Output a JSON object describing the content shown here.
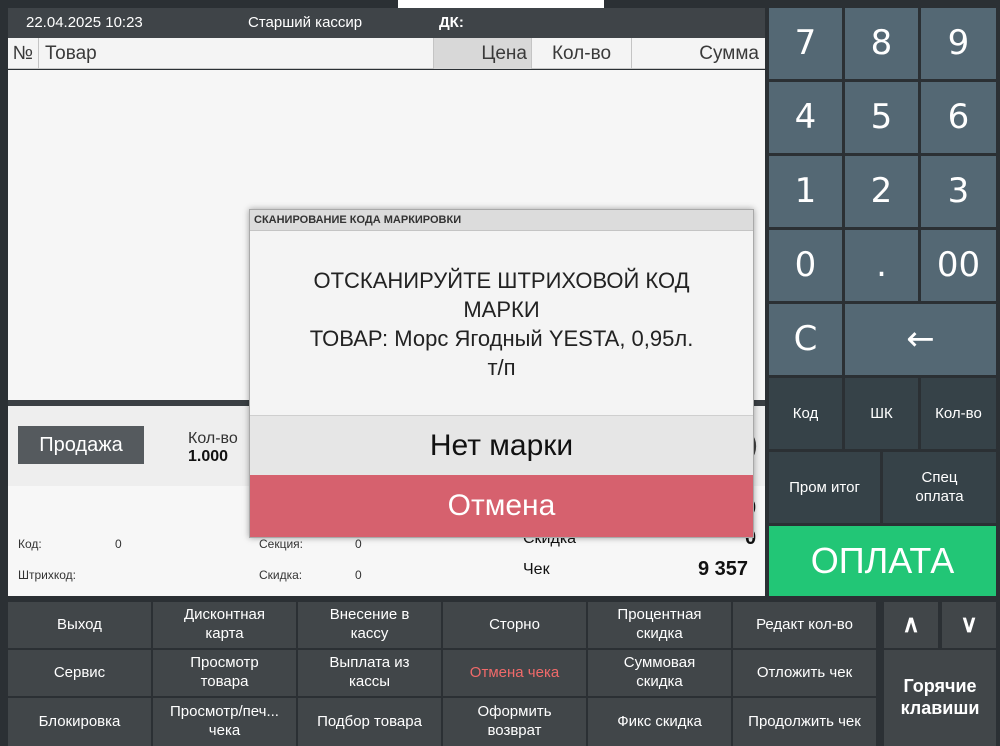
{
  "header": {
    "datetime": "22.04.2025 10:23",
    "role": "Старший кассир",
    "dk_label": "ДК:"
  },
  "table": {
    "col_no": "№",
    "col_item": "Товар",
    "col_price": "Цена",
    "col_qty": "Кол-во",
    "col_sum": "Сумма"
  },
  "info": {
    "mode_button": "Продажа",
    "qty_label": "Кол-во",
    "qty_value": "1.000",
    "code_label": "Код:",
    "code_value": "0",
    "barcode_label": "Штрихкод:",
    "section_label": "Секция:",
    "section_value": "0",
    "discount_label": "Скидка:",
    "discount_value": "0",
    "total_discount_label": "Скидка",
    "total_discount_value": "0",
    "check_label": "Чек",
    "check_value": "9 357",
    "partial_zero": "0",
    "partial_paren": ")"
  },
  "numpad": {
    "k7": "7",
    "k8": "8",
    "k9": "9",
    "k4": "4",
    "k5": "5",
    "k6": "6",
    "k1": "1",
    "k2": "2",
    "k3": "3",
    "k0": "0",
    "kdot": ".",
    "k00": "00",
    "kc": "C",
    "kback": "←"
  },
  "fn_keys": {
    "code": "Код",
    "barcode": "ШК",
    "qty": "Кол-во",
    "subtotal": "Пром итог",
    "special_payment": "Спец оплата",
    "pay": "ОПЛАТА"
  },
  "functions": {
    "exit": "Выход",
    "discount_card": "Дисконтная карта",
    "cash_in": "Внесение в кассу",
    "storno": "Сторно",
    "percent_discount": "Процентная скидка",
    "edit_qty": "Редакт кол-во",
    "service": "Сервис",
    "view_item": "Просмотр товара",
    "cash_out": "Выплата из кассы",
    "cancel_check": "Отмена чека",
    "sum_discount": "Суммовая скидка",
    "postpone_check": "Отложить чек",
    "lock": "Блокировка",
    "view_print_check": "Просмотр/печ... чека",
    "pick_item": "Подбор товара",
    "make_return": "Оформить возврат",
    "fixed_discount": "Фикс скидка",
    "resume_check": "Продолжить чек",
    "up": "∧",
    "down": "∨",
    "hotkeys": "Горячие клавиши"
  },
  "modal": {
    "title": "СКАНИРОВАНИЕ КОДА МАРКИРОВКИ",
    "line1": "ОТСКАНИРУЙТЕ ШТРИХОВОЙ КОД",
    "line2": "МАРКИ",
    "line3": "ТОВАР: Морс Ягодный YESTA, 0,95л.",
    "line4": "т/п",
    "no_mark_button": "Нет марки",
    "cancel_button": "Отмена"
  },
  "colors": {
    "pay_green": "#22c676",
    "cancel_red": "#d6616e",
    "numpad_blue": "#546874"
  }
}
